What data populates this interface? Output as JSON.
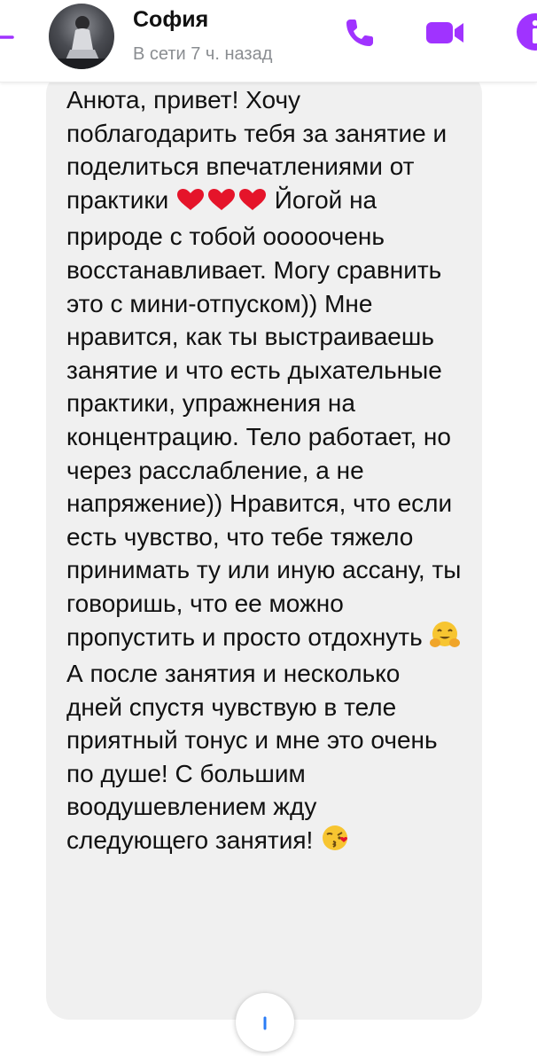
{
  "header": {
    "contact_name": "София",
    "status": "В сети 7 ч. назад"
  },
  "message": {
    "part1": "Анюта, привет! Хочу поблагодарить тебя за занятие и поделиться впечатлениями от практики ",
    "part2": " Йогой на природе с тобой ооооочень восстанавливает. Могу сравнить это с мини-отпуском)) Мне нравится, как ты выстраиваешь занятие и что есть дыхательные практики, упражнения на концентрацию. Тело работает, но через расслабление, а не напряжение)) Нравится, что если есть чувство, что тебе тяжело принимать ту или иную ассану, ты говоришь, что ее можно пропустить и просто отдохнуть ",
    "part3": " А после занятия и несколько дней спустя чувствую в теле приятный тонус и мне это очень по душе! С большим воодушевлением жду следующего занятия! ",
    "emojis": [
      "heart-emoji",
      "heart-emoji",
      "heart-emoji",
      "hugging-face-emoji",
      "kissing-face-emoji"
    ]
  },
  "colors": {
    "accent": "#a033ff",
    "bubble": "#f0f0f0",
    "status_text": "#8a8d91"
  },
  "icons": {
    "back": "back-arrow-icon",
    "call": "phone-icon",
    "video": "video-camera-icon",
    "info": "info-icon",
    "scroll": "scroll-down-icon"
  }
}
